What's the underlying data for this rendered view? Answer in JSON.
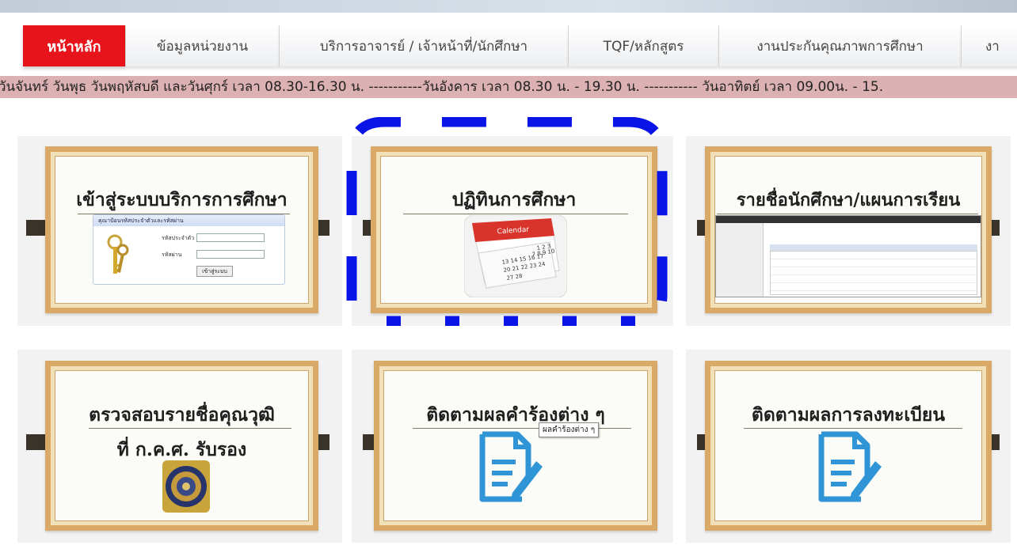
{
  "nav": {
    "tabs": [
      {
        "label": "หน้าหลัก",
        "active": true
      },
      {
        "label": "ข้อมูลหน่วยงาน",
        "active": false
      },
      {
        "label": "บริการอาจารย์ / เจ้าหน้าที่/นักศึกษา",
        "active": false
      },
      {
        "label": "TQF/หลักสูตร",
        "active": false
      },
      {
        "label": "งานประกันคุณภาพการศึกษา",
        "active": false
      },
      {
        "label": "งา",
        "active": false
      }
    ]
  },
  "marquee": {
    "text": "วันจันทร์ วันพุธ วันพฤหัสบดี และวันศุกร์ เวลา 08.30-16.30 น. -----------วันอังคาร เวลา 08.30 น. - 19.30 น. ----------- วันอาทิตย์ เวลา 09.00น. - 15."
  },
  "cards": {
    "education_service": {
      "title": "เข้าสู่ระบบบริการการศึกษา",
      "login_header": "คุณาป้อนรหัสประจำตัวและรหัสผ่าน",
      "id_label": "รหัสประจำตัว",
      "password_label": "รหัสผ่าน",
      "login_button": "เข้าสู่ระบบ"
    },
    "calendar": {
      "title": "ปฏิทินการศึกษา",
      "icon_label": "Calendar",
      "dates": "1 2 3 4 5 6 7 8 9 10 11 12 13 14 15 16 17 18 19 20 21 22 23 24 25 26 27 28"
    },
    "student_list": {
      "title": "รายชื่อนักศึกษา/แผนการเรียน"
    },
    "qualification": {
      "title_line1": "ตรวจสอบรายชื่อคุณวุฒิ",
      "title_line2": "ที่ ก.ค.ศ. รับรอง"
    },
    "petition": {
      "title": "ติดตามผลคำร้องต่าง ๆ",
      "tooltip": "ผลคำร้องต่าง ๆ"
    },
    "registration": {
      "title": "ติดตามผลการลงทะเบียน"
    }
  },
  "colors": {
    "active_tab": "#e8141b",
    "marquee_bg": "#dcb1b4",
    "dash_highlight": "#0a14e6",
    "doc_icon": "#2f95d6"
  },
  "icons": {
    "keys": "keys-icon",
    "calendar": "calendar-icon",
    "document_pen": "document-pen-icon",
    "seal": "ocsc-seal-icon"
  }
}
